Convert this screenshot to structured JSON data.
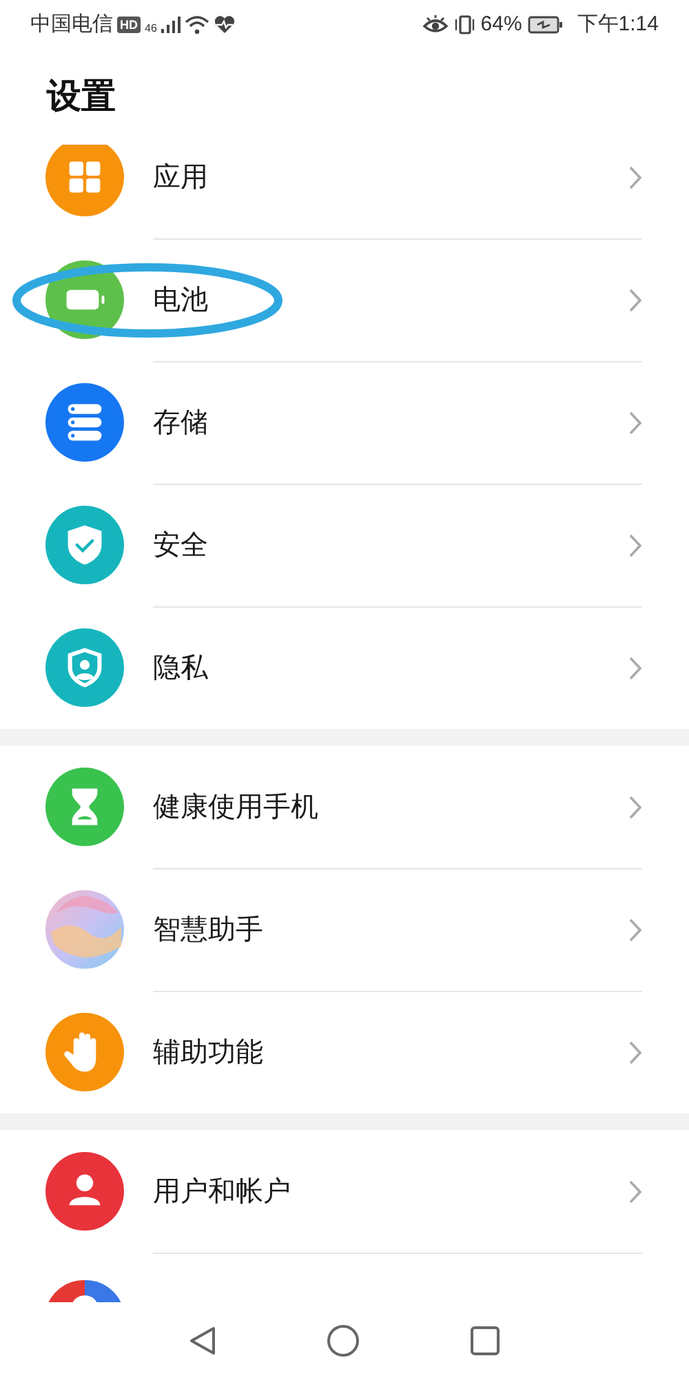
{
  "status_bar": {
    "carrier": "中国电信",
    "hd": "HD",
    "network": "46",
    "battery_percent": "64%",
    "time": "下午1:14"
  },
  "title": "设置",
  "groups": [
    {
      "items": [
        {
          "label": "应用",
          "highlighted": false
        },
        {
          "label": "电池",
          "highlighted": true
        },
        {
          "label": "存储",
          "highlighted": false
        },
        {
          "label": "安全",
          "highlighted": false
        },
        {
          "label": "隐私",
          "highlighted": false
        }
      ]
    },
    {
      "items": [
        {
          "label": "健康使用手机",
          "highlighted": false
        },
        {
          "label": "智慧助手",
          "highlighted": false
        },
        {
          "label": "辅助功能",
          "highlighted": false
        }
      ]
    },
    {
      "items": [
        {
          "label": "用户和帐户",
          "highlighted": false
        },
        {
          "kind": "partial",
          "highlighted": false
        }
      ]
    }
  ]
}
